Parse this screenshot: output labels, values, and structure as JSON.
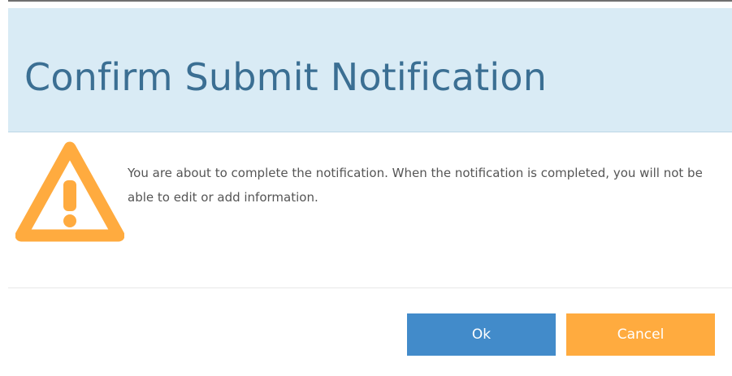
{
  "dialog": {
    "title": "Confirm Submit Notification",
    "icon": "warning-icon",
    "message": "You are about to complete the notification. When the notification is completed, you will not be able to edit or add information.",
    "buttons": {
      "ok_label": "Ok",
      "cancel_label": "Cancel"
    }
  },
  "colors": {
    "header_background": "#d9ebf5",
    "title_text": "#3b6f93",
    "warning": "#ffab3f",
    "ok_button": "#428bca",
    "cancel_button": "#ffab3f"
  }
}
